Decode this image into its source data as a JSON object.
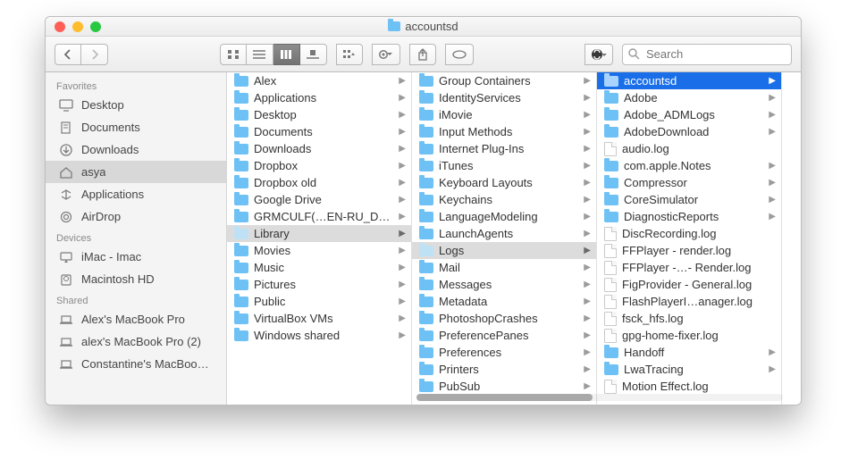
{
  "window_title": "accountsd",
  "search_placeholder": "Search",
  "sidebar": {
    "sections": [
      {
        "title": "Favorites",
        "items": [
          {
            "label": "Desktop",
            "icon": "desktop",
            "selected": false
          },
          {
            "label": "Documents",
            "icon": "docs",
            "selected": false
          },
          {
            "label": "Downloads",
            "icon": "downloads",
            "selected": false
          },
          {
            "label": "asya",
            "icon": "home",
            "selected": true
          },
          {
            "label": "Applications",
            "icon": "apps",
            "selected": false
          },
          {
            "label": "AirDrop",
            "icon": "airdrop",
            "selected": false
          }
        ]
      },
      {
        "title": "Devices",
        "items": [
          {
            "label": "iMac - Imac",
            "icon": "imac",
            "selected": false
          },
          {
            "label": "Macintosh HD",
            "icon": "hdd",
            "selected": false
          }
        ]
      },
      {
        "title": "Shared",
        "items": [
          {
            "label": "Alex's MacBook Pro",
            "icon": "laptop",
            "selected": false
          },
          {
            "label": "alex's MacBook Pro (2)",
            "icon": "laptop",
            "selected": false
          },
          {
            "label": "Constantine's MacBoo…",
            "icon": "laptop",
            "selected": false
          }
        ]
      }
    ]
  },
  "columns": [
    {
      "items": [
        {
          "label": "Alex",
          "kind": "folder",
          "expandable": true
        },
        {
          "label": "Applications",
          "kind": "folder",
          "expandable": true
        },
        {
          "label": "Desktop",
          "kind": "folder",
          "expandable": true
        },
        {
          "label": "Documents",
          "kind": "folder",
          "expandable": true
        },
        {
          "label": "Downloads",
          "kind": "folder",
          "expandable": true
        },
        {
          "label": "Dropbox",
          "kind": "folder",
          "expandable": true
        },
        {
          "label": "Dropbox old",
          "kind": "folder",
          "expandable": true
        },
        {
          "label": "Google Drive",
          "kind": "folder",
          "expandable": true
        },
        {
          "label": "GRMCULF(…EN-RU_DVD",
          "kind": "folder",
          "expandable": true
        },
        {
          "label": "Library",
          "kind": "folder",
          "expandable": true,
          "selected": true
        },
        {
          "label": "Movies",
          "kind": "folder",
          "expandable": true
        },
        {
          "label": "Music",
          "kind": "folder",
          "expandable": true
        },
        {
          "label": "Pictures",
          "kind": "folder",
          "expandable": true
        },
        {
          "label": "Public",
          "kind": "folder",
          "expandable": true
        },
        {
          "label": "VirtualBox VMs",
          "kind": "folder",
          "expandable": true
        },
        {
          "label": "Windows shared",
          "kind": "folder",
          "expandable": true
        }
      ]
    },
    {
      "items": [
        {
          "label": "Group Containers",
          "kind": "folder",
          "expandable": true
        },
        {
          "label": "IdentityServices",
          "kind": "folder",
          "expandable": true
        },
        {
          "label": "iMovie",
          "kind": "folder",
          "expandable": true
        },
        {
          "label": "Input Methods",
          "kind": "folder",
          "expandable": true
        },
        {
          "label": "Internet Plug-Ins",
          "kind": "folder",
          "expandable": true
        },
        {
          "label": "iTunes",
          "kind": "folder",
          "expandable": true
        },
        {
          "label": "Keyboard Layouts",
          "kind": "folder",
          "expandable": true
        },
        {
          "label": "Keychains",
          "kind": "folder",
          "expandable": true
        },
        {
          "label": "LanguageModeling",
          "kind": "folder",
          "expandable": true
        },
        {
          "label": "LaunchAgents",
          "kind": "folder",
          "expandable": true
        },
        {
          "label": "Logs",
          "kind": "folder",
          "expandable": true,
          "selected": true
        },
        {
          "label": "Mail",
          "kind": "folder",
          "expandable": true
        },
        {
          "label": "Messages",
          "kind": "folder",
          "expandable": true
        },
        {
          "label": "Metadata",
          "kind": "folder",
          "expandable": true
        },
        {
          "label": "PhotoshopCrashes",
          "kind": "folder",
          "expandable": true
        },
        {
          "label": "PreferencePanes",
          "kind": "folder",
          "expandable": true
        },
        {
          "label": "Preferences",
          "kind": "folder",
          "expandable": true
        },
        {
          "label": "Printers",
          "kind": "folder",
          "expandable": true
        },
        {
          "label": "PubSub",
          "kind": "folder",
          "expandable": true
        }
      ]
    },
    {
      "items": [
        {
          "label": "accountsd",
          "kind": "folder",
          "expandable": true,
          "highlight": true
        },
        {
          "label": "Adobe",
          "kind": "folder",
          "expandable": true
        },
        {
          "label": "Adobe_ADMLogs",
          "kind": "folder",
          "expandable": true
        },
        {
          "label": "AdobeDownload",
          "kind": "folder",
          "expandable": true
        },
        {
          "label": "audio.log",
          "kind": "file"
        },
        {
          "label": "com.apple.Notes",
          "kind": "folder",
          "expandable": true
        },
        {
          "label": "Compressor",
          "kind": "folder",
          "expandable": true
        },
        {
          "label": "CoreSimulator",
          "kind": "folder",
          "expandable": true
        },
        {
          "label": "DiagnosticReports",
          "kind": "folder",
          "expandable": true
        },
        {
          "label": "DiscRecording.log",
          "kind": "file"
        },
        {
          "label": "FFPlayer - render.log",
          "kind": "file"
        },
        {
          "label": "FFPlayer -…- Render.log",
          "kind": "file"
        },
        {
          "label": "FigProvider - General.log",
          "kind": "file"
        },
        {
          "label": "FlashPlayerI…anager.log",
          "kind": "file"
        },
        {
          "label": "fsck_hfs.log",
          "kind": "file"
        },
        {
          "label": "gpg-home-fixer.log",
          "kind": "file"
        },
        {
          "label": "Handoff",
          "kind": "folder",
          "expandable": true
        },
        {
          "label": "LwaTracing",
          "kind": "folder",
          "expandable": true
        },
        {
          "label": "Motion Effect.log",
          "kind": "file"
        }
      ]
    }
  ]
}
